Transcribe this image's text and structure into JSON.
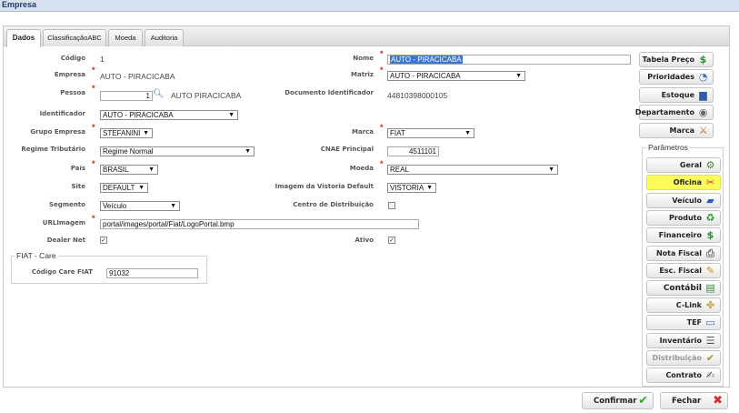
{
  "window": {
    "title": "Empresa"
  },
  "tabs": [
    {
      "label": "Dados"
    },
    {
      "label": "ClassificaçãoABC"
    },
    {
      "label": "Moeda"
    },
    {
      "label": "Auditoria"
    }
  ],
  "form": {
    "codigo": {
      "label": "Código",
      "value": "1"
    },
    "empresa": {
      "label": "Empresa",
      "value": "AUTO - PIRACICABA"
    },
    "pessoa": {
      "label": "Pessoa",
      "value": "1",
      "name": "AUTO PIRACICABA"
    },
    "identificador": {
      "label": "Identificador",
      "value": "AUTO - PIRACICABA"
    },
    "grupo_empresa": {
      "label": "Grupo Empresa",
      "value": "STEFANINI"
    },
    "regime_tributario": {
      "label": "Regime Tributário",
      "value": "Regime Normal"
    },
    "pais": {
      "label": "País",
      "value": "BRASIL"
    },
    "site": {
      "label": "Site",
      "value": "DEFAULT"
    },
    "segmento": {
      "label": "Segmento",
      "value": "Veículo"
    },
    "url_imagem": {
      "label": "URLImagem",
      "value": "portal/images/portal/Fiat/LogoPortal.bmp"
    },
    "dealer_net": {
      "label": "Dealer Net",
      "checked": true
    },
    "nome": {
      "label": "Nome",
      "value": "AUTO - PIRACICABA"
    },
    "matriz": {
      "label": "Matriz",
      "value": "AUTO - PIRACICABA"
    },
    "documento_identificador": {
      "label": "Documento Identificador",
      "value": "44810398000105"
    },
    "marca": {
      "label": "Marca",
      "value": "FIAT"
    },
    "cnae_principal": {
      "label": "CNAE Principal",
      "value": "4511101"
    },
    "moeda": {
      "label": "Moeda",
      "value": "REAL"
    },
    "imagem_vistoria": {
      "label": "Imagem da Vistoria Default",
      "value": "VISTORIA"
    },
    "centro_distribuicao": {
      "label": "Centro de Distribuição",
      "checked": false
    },
    "ativo": {
      "label": "Ativo",
      "checked": true
    }
  },
  "fiat_care": {
    "legend": "FIAT - Care",
    "codigo_care": {
      "label": "Código Care FIAT",
      "value": "91032"
    }
  },
  "side_buttons": {
    "tabela_preco": "Tabela Preço",
    "prioridades": "Prioridades",
    "estoque": "Estoque",
    "departamento": "Departamento",
    "marca": "Marca"
  },
  "parametros": {
    "title": "Parâmetros",
    "geral": "Geral",
    "oficina": "Oficina",
    "veiculo": "Veículo",
    "produto": "Produto",
    "financeiro": "Financeiro",
    "nota_fiscal": "Nota Fiscal",
    "esc_fiscal": "Esc. Fiscal",
    "contabil": "Contábil",
    "c_link": "C-Link",
    "tef": "TEF",
    "inventario": "Inventário",
    "distribuicao": "Distribuição",
    "contrato": "Contrato"
  },
  "footer": {
    "confirmar": "Confirmar",
    "fechar": "Fechar"
  },
  "colors": {
    "highlight": "#fbfb5a",
    "selection": "#3b78c9",
    "required": "#dd2211"
  },
  "icons": {
    "confirmar": "check-icon",
    "fechar": "close-icon",
    "pessoa_lookup": "magnifier-icon"
  }
}
